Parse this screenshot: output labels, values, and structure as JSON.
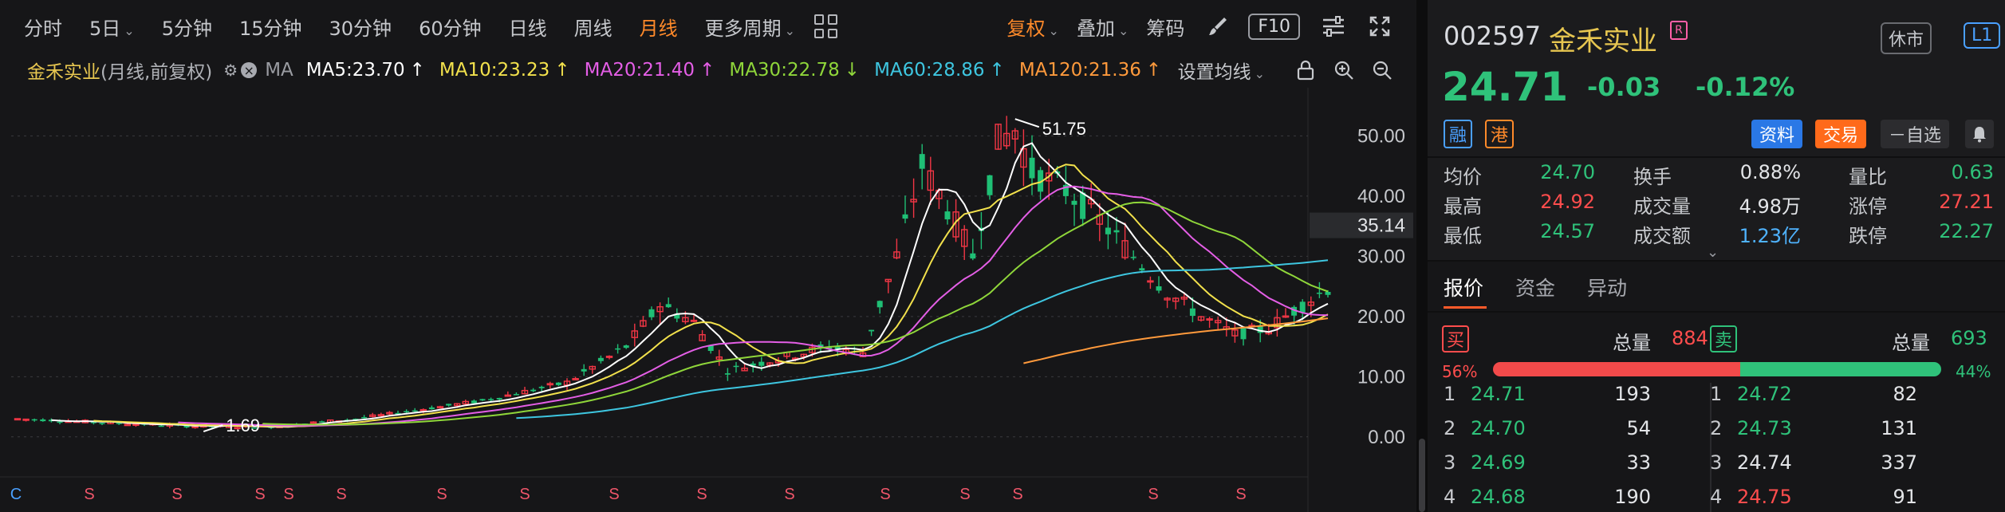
{
  "toolbar": {
    "periods": [
      {
        "label": "分时",
        "dropdown": false,
        "active": false
      },
      {
        "label": "5日",
        "dropdown": true,
        "active": false
      },
      {
        "label": "5分钟",
        "dropdown": false,
        "active": false
      },
      {
        "label": "15分钟",
        "dropdown": false,
        "active": false
      },
      {
        "label": "30分钟",
        "dropdown": false,
        "active": false
      },
      {
        "label": "60分钟",
        "dropdown": false,
        "active": false
      },
      {
        "label": "日线",
        "dropdown": false,
        "active": false
      },
      {
        "label": "周线",
        "dropdown": false,
        "active": false
      },
      {
        "label": "月线",
        "dropdown": false,
        "active": true
      },
      {
        "label": "更多周期",
        "dropdown": true,
        "active": false
      }
    ],
    "fuquan": "复权",
    "diejia": "叠加",
    "chouma": "筹码",
    "f10": "F10"
  },
  "ma_bar": {
    "stock_name": "金禾实业",
    "subtitle": "(月线,前复权)",
    "ma_label": "MA",
    "items": [
      {
        "text": "MA5:23.70",
        "arrow": "↑",
        "color": "#ffffff"
      },
      {
        "text": "MA10:23.23",
        "arrow": "↑",
        "color": "#f2e14c"
      },
      {
        "text": "MA20:21.40",
        "arrow": "↑",
        "color": "#e45ee6"
      },
      {
        "text": "MA30:22.78",
        "arrow": "↓",
        "color": "#8fd63a"
      },
      {
        "text": "MA60:28.86",
        "arrow": "↑",
        "color": "#3ec6e0"
      },
      {
        "text": "MA120:21.36",
        "arrow": "↑",
        "color": "#ff9a3c"
      }
    ],
    "setting": "设置均线"
  },
  "chart_data": {
    "type": "candlestick",
    "y_ticks": [
      "50.00",
      "40.00",
      "30.00",
      "20.00",
      "10.00",
      "0.00"
    ],
    "y_range": [
      -4,
      58
    ],
    "current_price_label": "35.14",
    "max_annotation": "51.75",
    "min_annotation": "1.69",
    "marker_row": [
      "C",
      "S",
      "S",
      "S",
      "S",
      "S",
      "S",
      "S",
      "S",
      "S",
      "S",
      "S",
      "S",
      "S",
      "S",
      "S"
    ],
    "colors": {
      "up": "#f23645",
      "down": "#1fbf75"
    }
  },
  "quote": {
    "code": "002597",
    "name": "金禾实业",
    "tag": "R",
    "status": "休市",
    "level": "L1",
    "price": "24.71",
    "change": "-0.03",
    "change_pct": "-0.12%",
    "rong": "融",
    "gang": "港",
    "btn_info": "资料",
    "btn_trade": "交易",
    "btn_watch": "－自选",
    "stats": [
      [
        {
          "label": "均价",
          "value": "24.70",
          "color": "#2fc27a"
        },
        {
          "label": "换手",
          "value": "0.88%",
          "color": "#e3e5e8"
        },
        {
          "label": "量比",
          "value": "0.63",
          "color": "#2fc27a"
        }
      ],
      [
        {
          "label": "最高",
          "value": "24.92",
          "color": "#ff4d4d"
        },
        {
          "label": "成交量",
          "value": "4.98万",
          "color": "#e3e5e8"
        },
        {
          "label": "涨停",
          "value": "27.21",
          "color": "#ff4d4d"
        }
      ],
      [
        {
          "label": "最低",
          "value": "24.57",
          "color": "#2fc27a"
        },
        {
          "label": "成交额",
          "value": "1.23亿",
          "color": "#4fb3ff"
        },
        {
          "label": "跌停",
          "value": "22.27",
          "color": "#2fc27a"
        }
      ]
    ],
    "tabs": [
      "报价",
      "资金",
      "异动"
    ],
    "buy_badge": "买",
    "sell_badge": "卖",
    "total_label": "总量",
    "total_buy": "884",
    "total_sell": "693",
    "buy_pct": "56%",
    "sell_pct": "44%",
    "bids": [
      {
        "n": "1",
        "price": "24.71",
        "vol": "193",
        "color": "#2fc27a"
      },
      {
        "n": "2",
        "price": "24.70",
        "vol": "54",
        "color": "#2fc27a"
      },
      {
        "n": "3",
        "price": "24.69",
        "vol": "33",
        "color": "#2fc27a"
      },
      {
        "n": "4",
        "price": "24.68",
        "vol": "190",
        "color": "#2fc27a"
      }
    ],
    "asks": [
      {
        "n": "1",
        "price": "24.72",
        "vol": "82",
        "color": "#2fc27a"
      },
      {
        "n": "2",
        "price": "24.73",
        "vol": "131",
        "color": "#2fc27a"
      },
      {
        "n": "3",
        "price": "24.74",
        "vol": "337",
        "color": "#e3e5e8"
      },
      {
        "n": "4",
        "price": "24.75",
        "vol": "91",
        "color": "#ff4d4d"
      }
    ]
  }
}
